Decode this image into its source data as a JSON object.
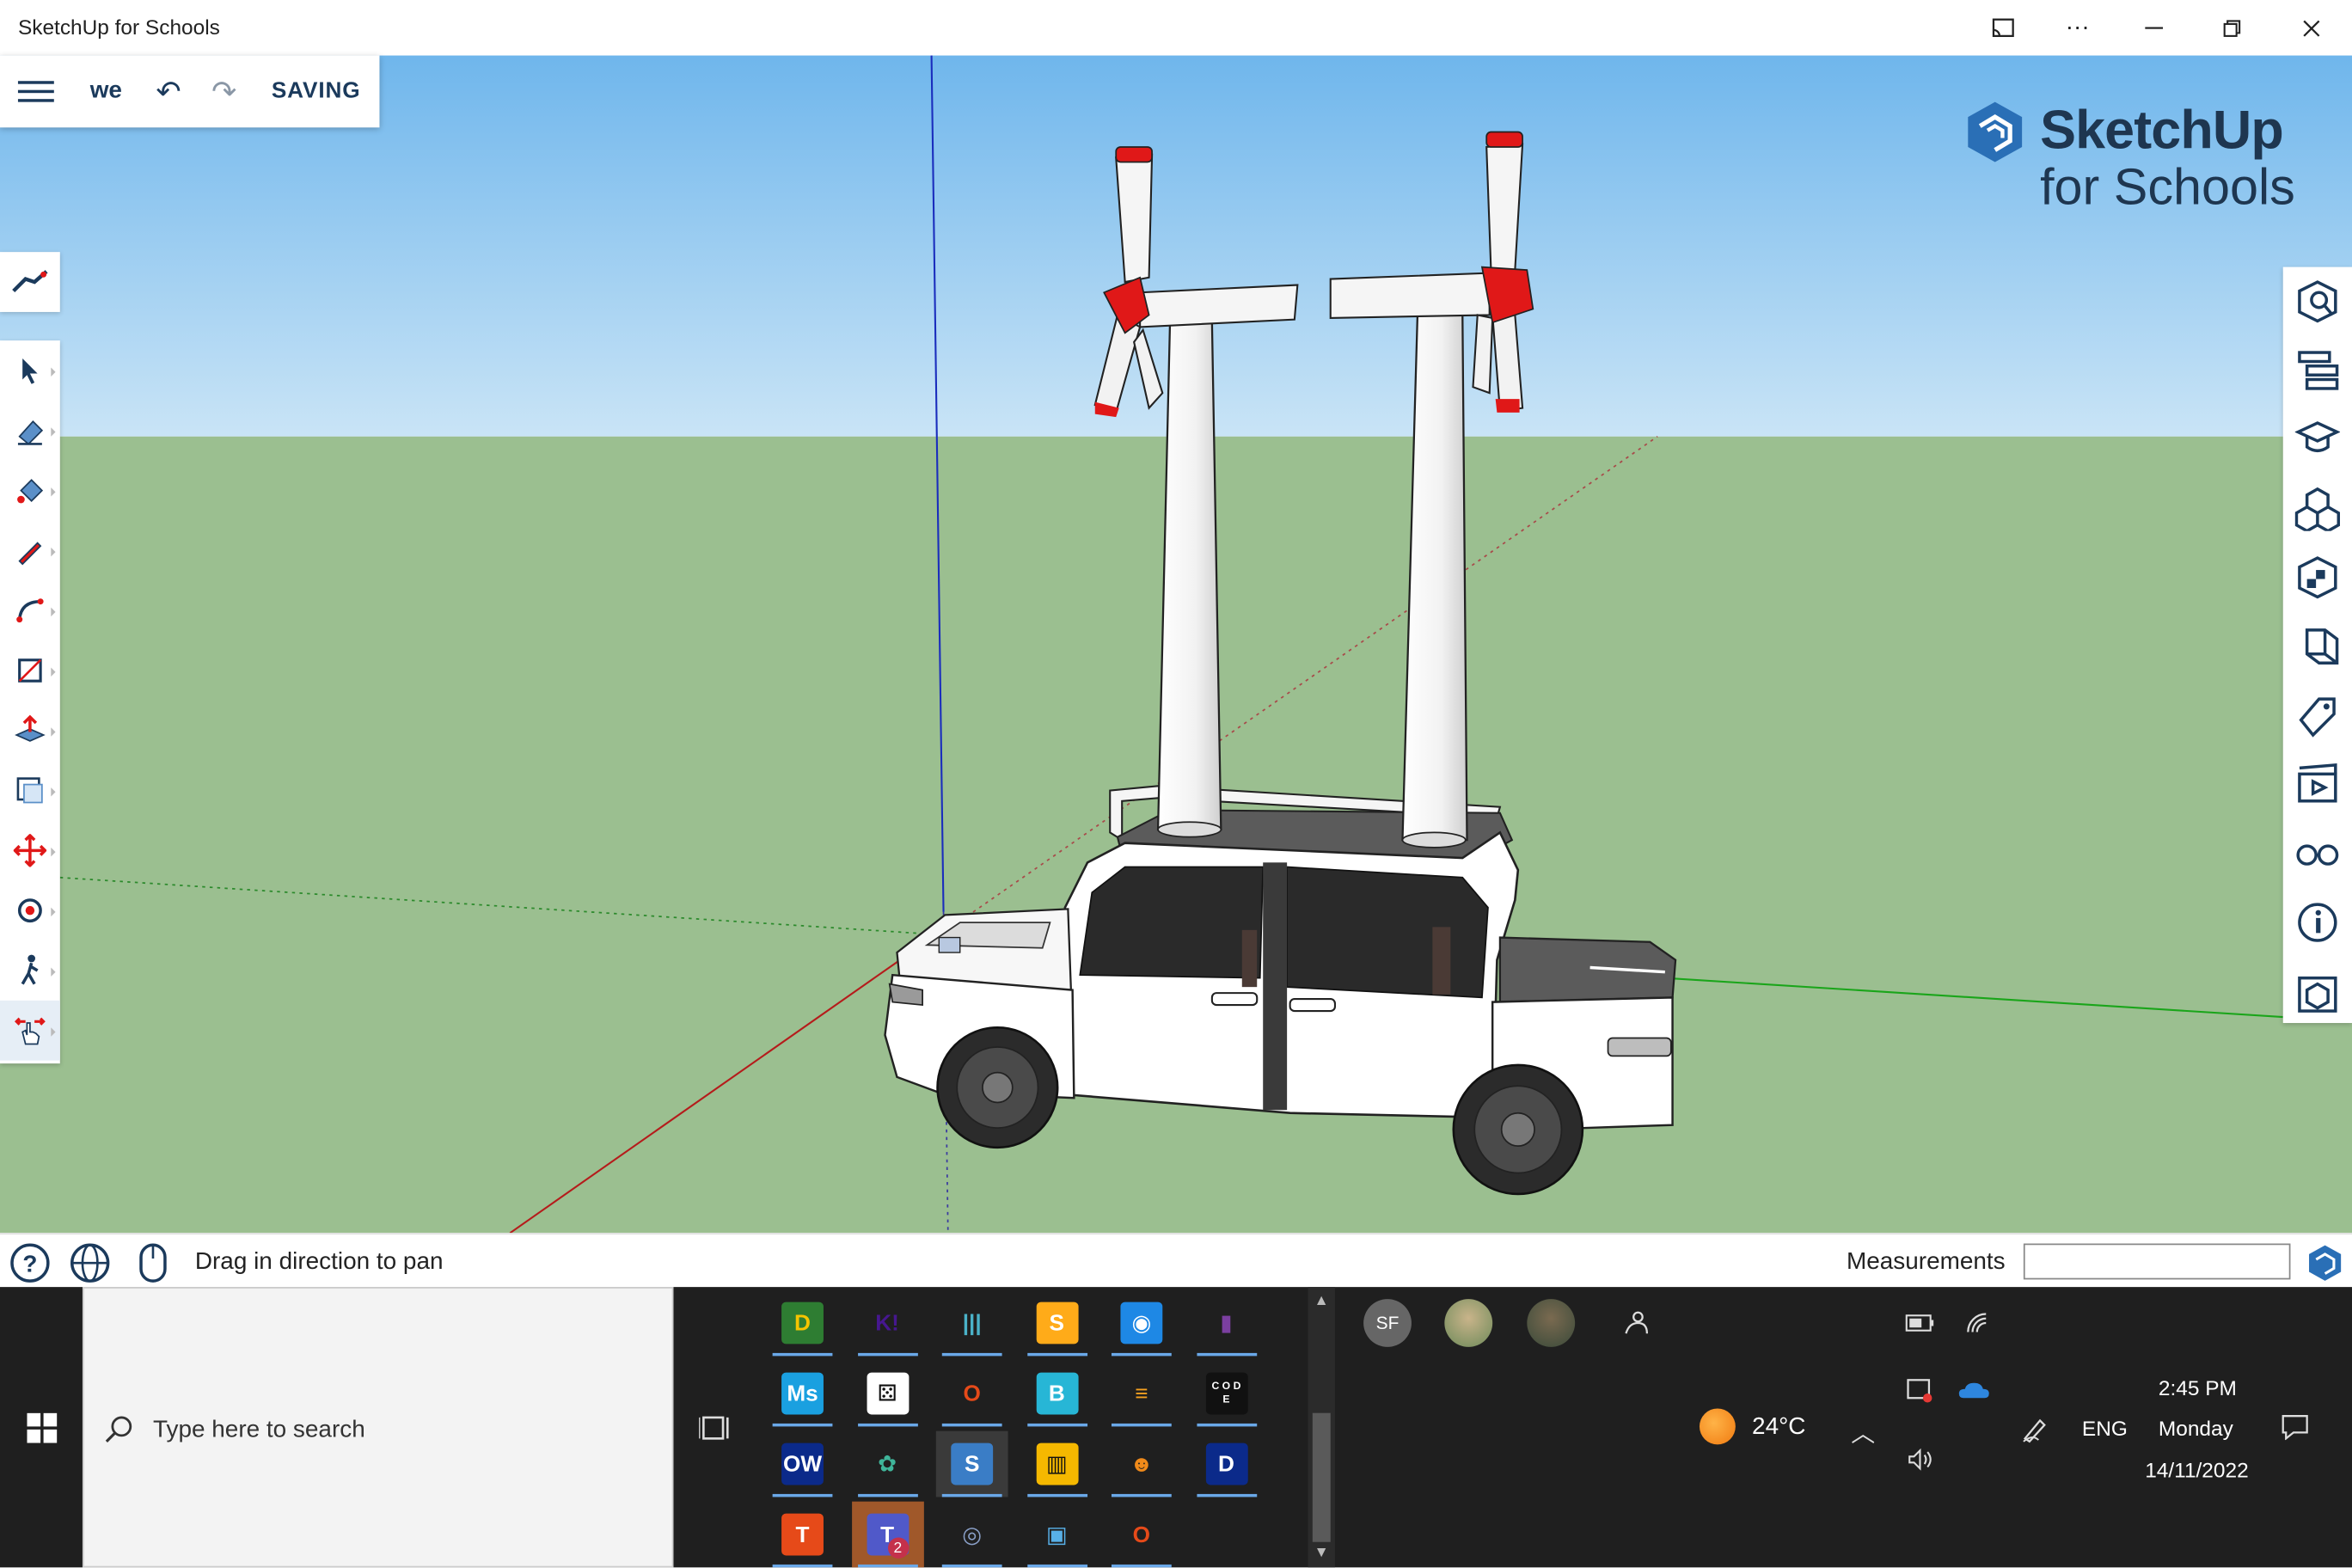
{
  "window": {
    "title": "SketchUp for Schools",
    "controls": [
      "cast-icon",
      "more-icon",
      "minimize-icon",
      "restore-icon",
      "close-icon"
    ]
  },
  "toolbar": {
    "file_name": "we",
    "status": "SAVING"
  },
  "brand": {
    "line1": "SketchUp",
    "line2": "for Schools"
  },
  "left_tools": [
    "search-tool-icon",
    "select-icon",
    "eraser-icon",
    "paint-bucket-icon",
    "pencil-icon",
    "arc-icon",
    "shape-icon",
    "push-pull-icon",
    "offset-icon",
    "move-icon",
    "orbit-icon",
    "walk-icon",
    "pan-icon"
  ],
  "right_panel": [
    "entity-info-icon",
    "outliner-icon",
    "instructor-icon",
    "components-icon",
    "materials-icon",
    "styles-icon",
    "tags-icon",
    "scenes-icon",
    "display-icon",
    "model-info-icon",
    "solid-inspector-icon"
  ],
  "statusbar": {
    "hint": "Drag in direction to pan",
    "measurements_label": "Measurements",
    "measurements_value": ""
  },
  "taskbar": {
    "search_placeholder": "Type here to search",
    "weather_temp": "24°C",
    "language": "ENG",
    "time": "2:45 PM",
    "day": "Monday",
    "date": "14/11/2022",
    "people_initials": "SF",
    "teams_badge": "2"
  },
  "apps": [
    {
      "name": "dyslexia-app",
      "label": "D",
      "color": "#2e7d32",
      "text": "#f5c400"
    },
    {
      "name": "kahoot-app",
      "label": "K!",
      "color": "transparent",
      "text": "#46178f"
    },
    {
      "name": "library-app",
      "label": "|||",
      "color": "transparent",
      "text": "#4ab2c8"
    },
    {
      "name": "scratch-app",
      "label": "S",
      "color": "#ffab19",
      "text": "#fff"
    },
    {
      "name": "robot-app",
      "label": "◉",
      "color": "#1e88e5",
      "text": "#fff"
    },
    {
      "name": "onenote-app",
      "label": "▮",
      "color": "transparent",
      "text": "#7b3fa0"
    },
    {
      "name": "mathspace-app",
      "label": "Ms",
      "color": "#1aa0e0",
      "text": "#fff"
    },
    {
      "name": "dice-app",
      "label": "⚄",
      "color": "#fff",
      "text": "#111"
    },
    {
      "name": "office-app",
      "label": "O",
      "color": "transparent",
      "text": "#e64a19"
    },
    {
      "name": "brainpop-app",
      "label": "B",
      "color": "#27b6d6",
      "text": "#fff"
    },
    {
      "name": "stack-app",
      "label": "≡",
      "color": "transparent",
      "text": "#f4a020"
    },
    {
      "name": "code-app",
      "label": "C O D E",
      "color": "#111",
      "text": "#fff"
    },
    {
      "name": "owl-app",
      "label": "OW",
      "color": "#0b2a8a",
      "text": "#fff"
    },
    {
      "name": "frog-app",
      "label": "✿",
      "color": "transparent",
      "text": "#3fb59a"
    },
    {
      "name": "sketchup-app",
      "label": "S",
      "color": "#3a7dc6",
      "text": "#fff"
    },
    {
      "name": "piano-app",
      "label": "▥",
      "color": "#f5b800",
      "text": "#111"
    },
    {
      "name": "mascot-app",
      "label": "☻",
      "color": "transparent",
      "text": "#f08a1a"
    },
    {
      "name": "docs-app",
      "label": "D",
      "color": "#0b2a8a",
      "text": "#fff"
    },
    {
      "name": "t-app",
      "label": "T",
      "color": "#e64a19",
      "text": "#fff"
    },
    {
      "name": "teams-app",
      "label": "T",
      "color": "#5059c9",
      "text": "#fff"
    },
    {
      "name": "camera-app",
      "label": "◎",
      "color": "transparent",
      "text": "#8aa0c8"
    },
    {
      "name": "id-app",
      "label": "▣",
      "color": "transparent",
      "text": "#58b0e8"
    },
    {
      "name": "office2-app",
      "label": "O",
      "color": "transparent",
      "text": "#e64a19"
    }
  ],
  "colors": {
    "sky": "#85c4f0",
    "ground": "#9bbf90",
    "brand": "#1e3650",
    "taskbar": "#1f1f1f"
  }
}
